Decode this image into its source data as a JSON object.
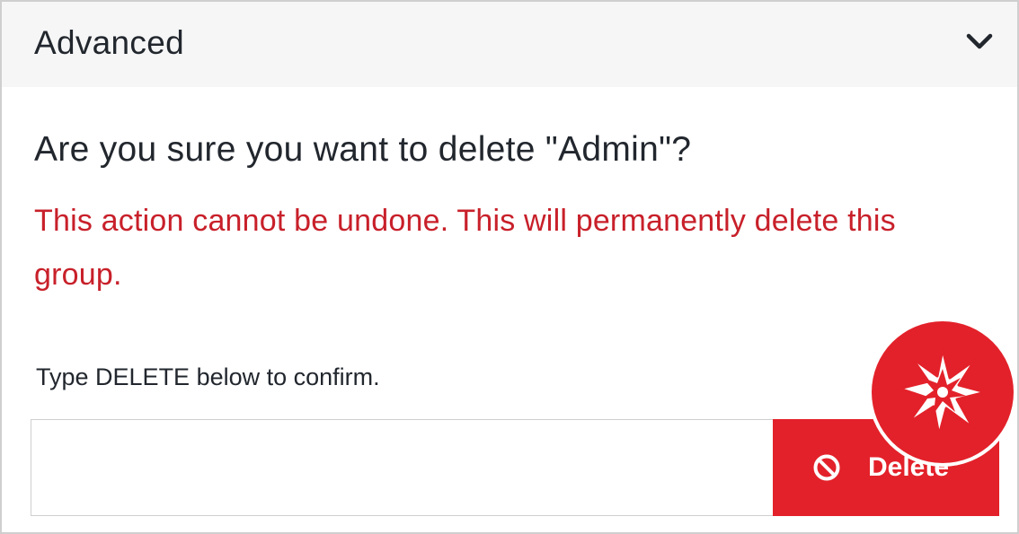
{
  "section": {
    "title": "Advanced",
    "toggle_icon": "chevron-down-icon"
  },
  "dialog": {
    "question": "Are you sure you want to delete \"Admin\"?",
    "warning": "This action cannot be undone. This will permanently delete this group.",
    "confirm_label": "Type DELETE below to confirm.",
    "confirm_input_value": "",
    "delete_button_label": "Delete",
    "delete_button_icon": "ban-icon"
  },
  "brand": {
    "icon": "starburst-logo-icon"
  },
  "colors": {
    "danger": "#e3212a",
    "warning_text": "#c8202a",
    "header_bg": "#f6f6f6",
    "text": "#22272e"
  }
}
